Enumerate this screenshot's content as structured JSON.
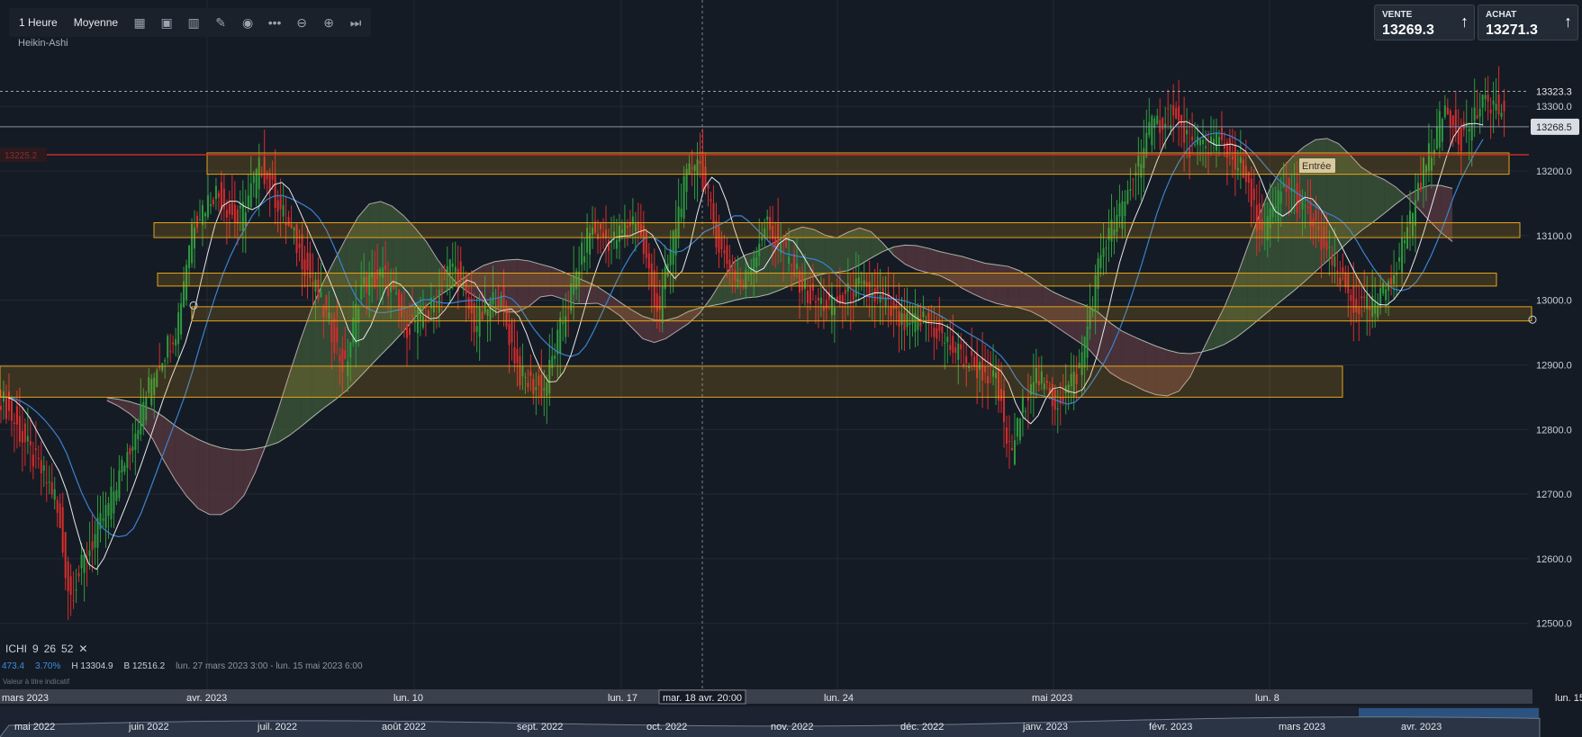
{
  "toolbar": {
    "interval": "1 Heure",
    "mode": "Moyenne",
    "icons": [
      "calendar-icon",
      "template-icon",
      "bars-icon",
      "pencil-icon",
      "eye-icon",
      "more-icon",
      "zoom-out-icon",
      "zoom-in-icon",
      "skip-end-icon"
    ]
  },
  "chart_type_label": "Heikin-Ashi",
  "sell": {
    "label": "VENTE",
    "value": "13269.3"
  },
  "buy": {
    "label": "ACHAT",
    "value": "13271.3"
  },
  "colors": {
    "background": "#151b24",
    "bull_candle": "#2e9a3e",
    "bear_candle": "#d62d2d",
    "kijun": "#3b82d0",
    "tenkan": "#e8e8e8",
    "kumo_bull": "#3d5a3a",
    "kumo_bear": "#5a3a40",
    "zone": "#e3a31a",
    "entry_line": "#d62d2d"
  },
  "indicator": {
    "name": "ICHI",
    "params": [
      "9",
      "26",
      "52"
    ],
    "close": "✕",
    "stats": {
      "v1": "473.4",
      "v2": "3.70%",
      "high": "H 13304.9",
      "low": "B 12516.2",
      "range": "lun. 27 mars 2023 3:00 - lun. 15 mai 2023 6:00"
    },
    "disclaimer": "Valeur à titre indicatif"
  },
  "chart_data": {
    "type": "candlestick",
    "title": "",
    "subtitle": "Heikin-Ashi",
    "yaxis": {
      "ticks": [
        13300,
        13200,
        13100,
        13000,
        12900,
        12800,
        12700,
        12600,
        12500
      ],
      "labels": [
        "13300.0",
        "13200.0",
        "13100.0",
        "13000.0",
        "12900.0",
        "12800.0",
        "12700.0",
        "12600.0",
        "12500.0"
      ]
    },
    "ylim": [
      12398,
      13395
    ],
    "price_markers": [
      {
        "value": 13323.3,
        "label": "13323.3",
        "style": "dashed"
      },
      {
        "value": 13268.5,
        "label": "13268.5",
        "style": "current"
      },
      {
        "value": 13225.2,
        "label": "13225.2",
        "style": "entry"
      }
    ],
    "annotation": {
      "text": "Entrée",
      "value": 13225.2
    },
    "x_axis": {
      "labels": [
        "mars 2023",
        "avr. 2023",
        "lun. 10",
        "lun. 17",
        "lun. 24",
        "mai 2023",
        "lun. 8",
        "lun. 15"
      ],
      "crosshair_label": "mar. 18 avr. 20:00"
    },
    "navigator": {
      "labels": [
        "mai 2022",
        "juin 2022",
        "juil. 2022",
        "août 2022",
        "sept. 2022",
        "oct. 2022",
        "nov. 2022",
        "déc. 2022",
        "janv. 2023",
        "févr. 2023",
        "mars 2023",
        "avr. 2023"
      ]
    },
    "zones": [
      {
        "low": 13195,
        "high": 13228
      },
      {
        "low": 13097,
        "high": 13120
      },
      {
        "low": 13022,
        "high": 13042
      },
      {
        "low": 12968,
        "high": 12990
      },
      {
        "low": 12850,
        "high": 12898
      }
    ],
    "series": [
      {
        "name": "Heikin-Ashi",
        "type": "candlestick"
      },
      {
        "name": "Tenkan",
        "type": "line"
      },
      {
        "name": "Kijun",
        "type": "line"
      },
      {
        "name": "Kumo",
        "type": "area"
      }
    ],
    "price_path": [
      [
        0.0,
        12850
      ],
      [
        0.02,
        12760
      ],
      [
        0.035,
        12700
      ],
      [
        0.045,
        12540
      ],
      [
        0.055,
        12600
      ],
      [
        0.07,
        12680
      ],
      [
        0.085,
        12780
      ],
      [
        0.1,
        12890
      ],
      [
        0.115,
        12960
      ],
      [
        0.125,
        13120
      ],
      [
        0.14,
        13170
      ],
      [
        0.155,
        13120
      ],
      [
        0.17,
        13210
      ],
      [
        0.185,
        13130
      ],
      [
        0.2,
        13050
      ],
      [
        0.215,
        12960
      ],
      [
        0.225,
        12890
      ],
      [
        0.235,
        13020
      ],
      [
        0.25,
        13040
      ],
      [
        0.265,
        12960
      ],
      [
        0.28,
        12980
      ],
      [
        0.295,
        13060
      ],
      [
        0.31,
        12960
      ],
      [
        0.325,
        13010
      ],
      [
        0.34,
        12880
      ],
      [
        0.355,
        12860
      ],
      [
        0.37,
        12990
      ],
      [
        0.385,
        13110
      ],
      [
        0.4,
        13090
      ],
      [
        0.415,
        13130
      ],
      [
        0.43,
        12980
      ],
      [
        0.445,
        13160
      ],
      [
        0.455,
        13230
      ],
      [
        0.47,
        13080
      ],
      [
        0.485,
        13020
      ],
      [
        0.5,
        13120
      ],
      [
        0.515,
        13060
      ],
      [
        0.53,
        13000
      ],
      [
        0.545,
        12990
      ],
      [
        0.56,
        13020
      ],
      [
        0.575,
        13000
      ],
      [
        0.59,
        12960
      ],
      [
        0.605,
        12970
      ],
      [
        0.62,
        12930
      ],
      [
        0.635,
        12900
      ],
      [
        0.65,
        12880
      ],
      [
        0.66,
        12760
      ],
      [
        0.675,
        12890
      ],
      [
        0.69,
        12840
      ],
      [
        0.705,
        12890
      ],
      [
        0.72,
        13080
      ],
      [
        0.735,
        13150
      ],
      [
        0.75,
        13260
      ],
      [
        0.765,
        13290
      ],
      [
        0.78,
        13230
      ],
      [
        0.795,
        13250
      ],
      [
        0.81,
        13210
      ],
      [
        0.825,
        13100
      ],
      [
        0.84,
        13180
      ],
      [
        0.855,
        13130
      ],
      [
        0.87,
        13060
      ],
      [
        0.885,
        12990
      ],
      [
        0.9,
        12990
      ],
      [
        0.915,
        13070
      ],
      [
        0.93,
        13200
      ],
      [
        0.945,
        13300
      ],
      [
        0.955,
        13250
      ],
      [
        0.965,
        13290
      ],
      [
        0.975,
        13310
      ],
      [
        0.985,
        13270
      ]
    ]
  }
}
